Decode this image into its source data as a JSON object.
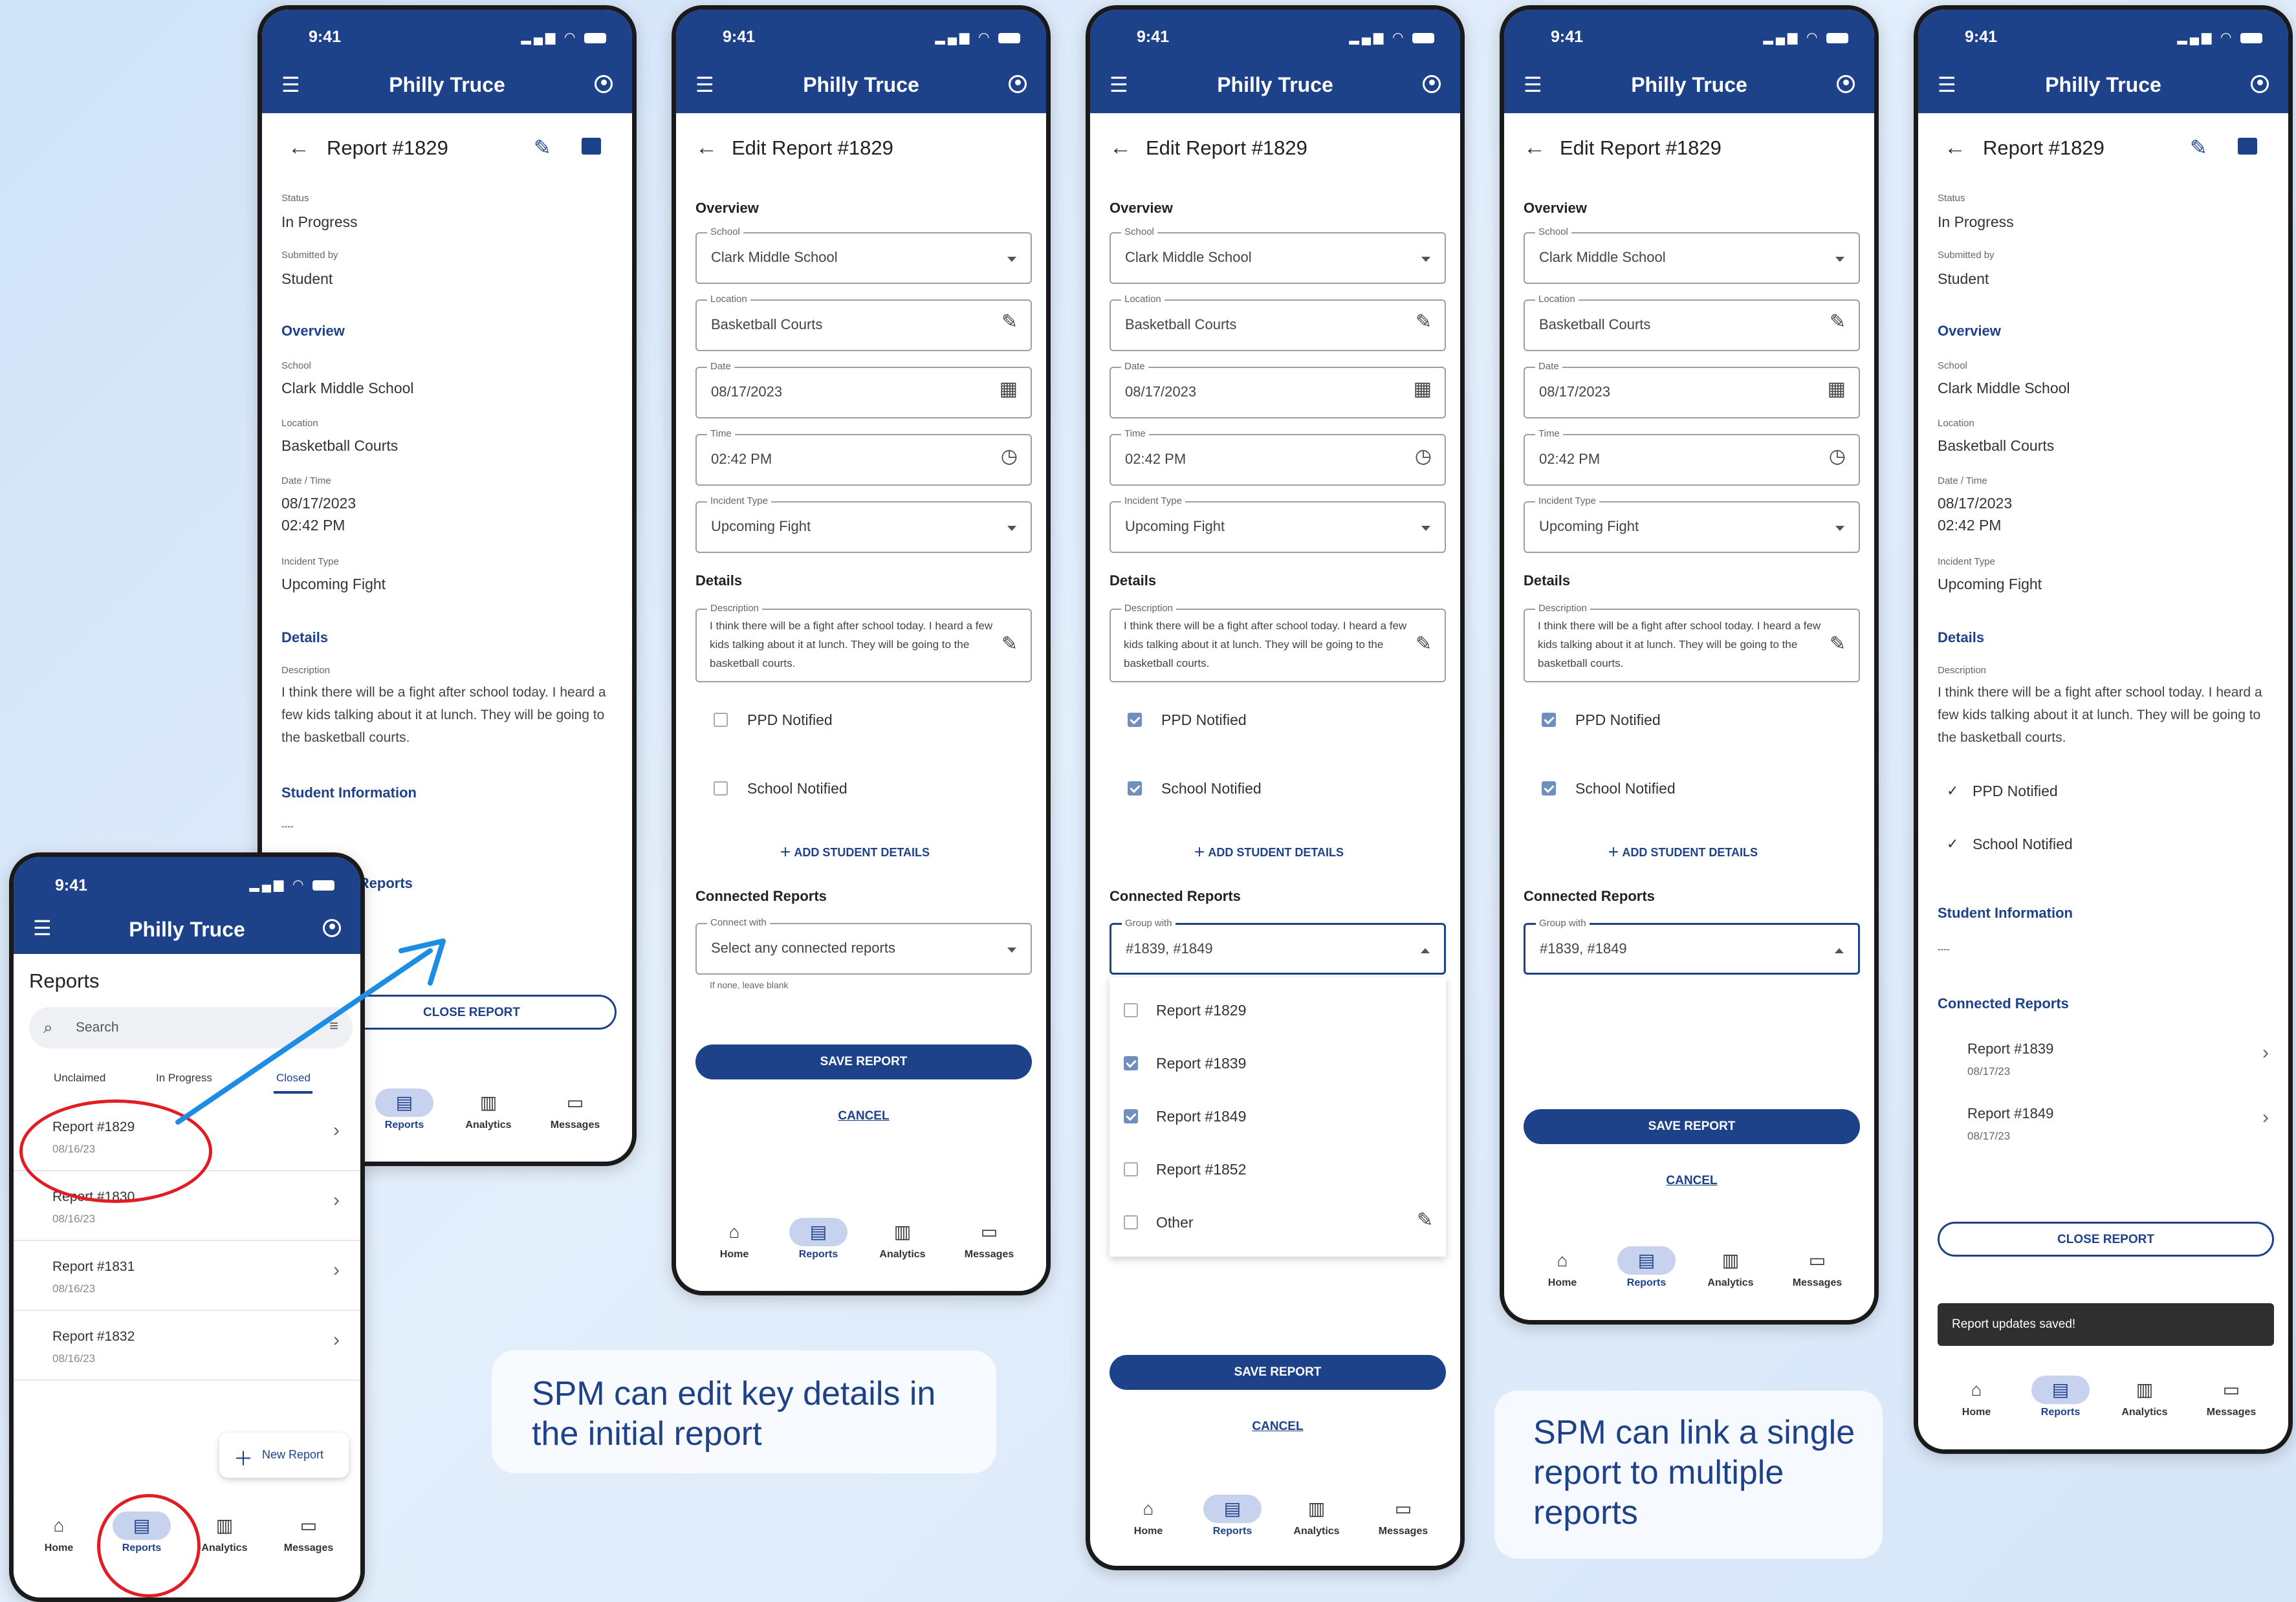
{
  "app": {
    "time": "9:41",
    "title": "Philly Truce"
  },
  "nav": {
    "home": "Home",
    "reports": "Reports",
    "analytics": "Analytics",
    "messages": "Messages"
  },
  "report": {
    "title": "Report #1829",
    "edit_title": "Edit Report #1829",
    "status_label": "Status",
    "status": "In Progress",
    "submitted_label": "Submitted by",
    "submitted": "Student",
    "overview": "Overview",
    "school_label": "School",
    "school": "Clark Middle School",
    "location_label": "Location",
    "location": "Basketball Courts",
    "datetime_label": "Date / Time",
    "date": "08/17/2023",
    "time": "02:42 PM",
    "date_label": "Date",
    "time_label": "Time",
    "incident_label": "Incident Type",
    "incident": "Upcoming Fight",
    "details": "Details",
    "description_label": "Description",
    "description": "I think there will be a fight after school today. I heard a few kids talking about it at lunch. They will be going to the basketball courts.",
    "student_info": "Student Information",
    "student_info_value": "----",
    "ppd": "PPD Notified",
    "school_notified": "School Notified",
    "add_student": "ADD STUDENT DETAILS",
    "connected": "Connected Reports",
    "connect_with": "Connect with",
    "connect_placeholder": "Select any connected reports",
    "help": "If none, leave blank",
    "group_with": "Group with",
    "group_value": "#1839, #1849",
    "save": "SAVE REPORT",
    "cancel": "CANCEL",
    "close": "CLOSE REPORT",
    "toast": "Report updates saved!",
    "dropdown": [
      "Report #1829",
      "Report #1839",
      "Report #1849",
      "Report #1852",
      "Other"
    ],
    "conn_items": [
      {
        "title": "Report #1839",
        "date": "08/17/23"
      },
      {
        "title": "Report #1849",
        "date": "08/17/23"
      }
    ]
  },
  "reports_list": {
    "heading": "Reports",
    "search": "Search",
    "tabs": [
      "Unclaimed",
      "In Progress",
      "Closed"
    ],
    "items": [
      {
        "title": "Report #1829",
        "date": "08/16/23"
      },
      {
        "title": "Report #1830",
        "date": "08/16/23"
      },
      {
        "title": "Report #1831",
        "date": "08/16/23"
      },
      {
        "title": "Report #1832",
        "date": "08/16/23"
      }
    ],
    "new_report": "New Report"
  },
  "captions": {
    "edit": "SPM can edit key details in the initial report",
    "link": "SPM can link a single report to multiple reports"
  },
  "colors": {
    "primary": "#1e428a",
    "highlight": "#e31b23",
    "arrow": "#1b8de4"
  }
}
